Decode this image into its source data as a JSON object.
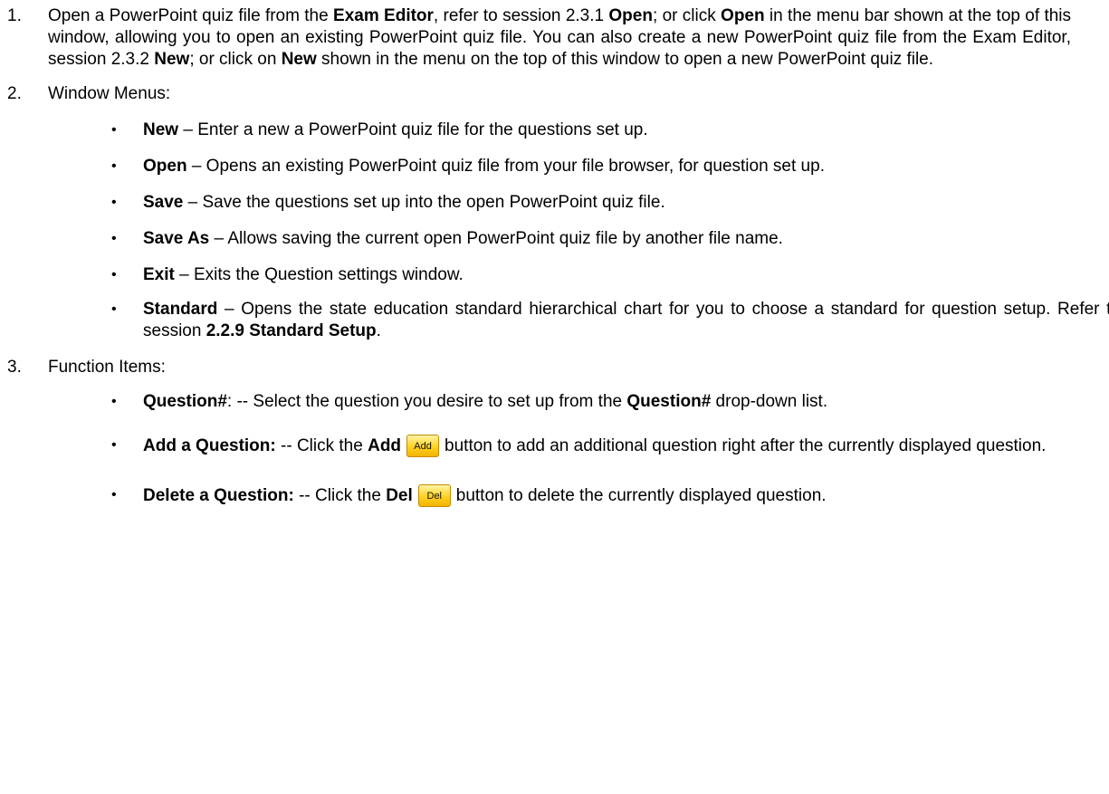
{
  "item1": {
    "num": "1.",
    "t1": "Open a PowerPoint quiz file from the ",
    "b1": "Exam Editor",
    "t2": ", refer to session 2.3.1 ",
    "b2": "Open",
    "t3": "; or click ",
    "b3": "Open",
    "t4": " in the menu bar shown at the top of this window, allowing you to open an existing PowerPoint quiz file. You can also create a new PowerPoint quiz file from the Exam Editor, session 2.3.2 ",
    "b4": "New",
    "t5": "; or click on ",
    "b5": "New",
    "t6": " shown in the menu on the top of this window to open a new PowerPoint quiz file."
  },
  "item2": {
    "num": "2.",
    "heading": "Window Menus:",
    "menus": {
      "new": {
        "label": "New",
        "desc": " – Enter a new a PowerPoint quiz file for the questions set up."
      },
      "open": {
        "label": "Open",
        "desc": " – Opens an existing PowerPoint quiz file from your file browser, for question set up."
      },
      "save": {
        "label": "Save",
        "desc": " – Save the questions set up into the open PowerPoint quiz file."
      },
      "save_as": {
        "label": "Save As",
        "desc": " – Allows saving the current open PowerPoint quiz file by another file name."
      },
      "exit": {
        "label": "Exit",
        "desc": " – Exits the Question settings window."
      },
      "standard": {
        "label": "Standard",
        "desc": " – Opens the state education standard hierarchical chart for you to choose a standard for question setup. Refer to session ",
        "ref": "2.2.9 Standard Setup",
        "end": "."
      }
    }
  },
  "item3": {
    "num": "3.",
    "heading": "Function Items:",
    "functions": {
      "question": {
        "label": "Question#",
        "t1": ": -- Select the question you desire to set up from the ",
        "b1": "Question#",
        "t2": " drop-down list."
      },
      "add": {
        "label": "Add a Question:",
        "t1": " -- Click the ",
        "b1": "Add",
        "btn": "Add",
        "t2": "button to add an additional question right after the currently displayed question."
      },
      "del": {
        "label": "Delete a Question:",
        "t1": " -- Click the ",
        "b1": "Del",
        "btn": "Del",
        "t2": "button to delete the currently displayed question."
      }
    }
  },
  "bullet_char": "•",
  "colors": {
    "text": "#000000",
    "button_fill": "#ffd21f",
    "button_border": "#c48a00"
  }
}
